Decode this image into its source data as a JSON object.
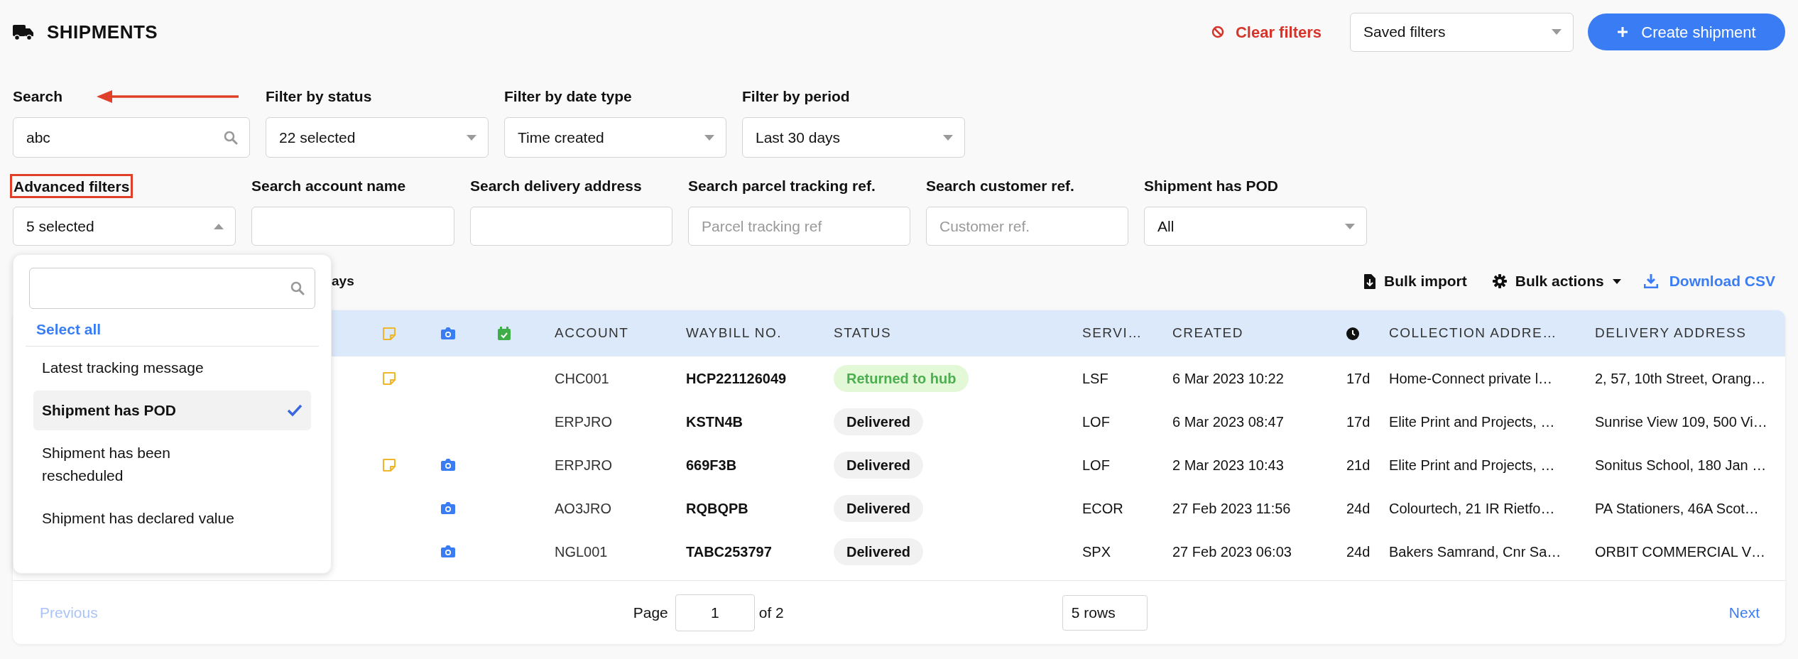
{
  "header": {
    "title": "SHIPMENTS",
    "clear_filters": "Clear filters",
    "saved_filters": "Saved filters",
    "create_button": "Create shipment"
  },
  "filters_row1": [
    {
      "label": "Search",
      "kind": "search",
      "value": "abc"
    },
    {
      "label": "Filter by status",
      "kind": "select",
      "value": "22 selected",
      "expanded": false
    },
    {
      "label": "Filter by date type",
      "kind": "select",
      "value": "Time created",
      "expanded": false
    },
    {
      "label": "Filter by period",
      "kind": "select",
      "value": "Last 30 days",
      "expanded": false
    }
  ],
  "filters_row2": [
    {
      "label": "Advanced filters",
      "kind": "select",
      "value": "5 selected",
      "expanded": true,
      "highlighted": true
    },
    {
      "label": "Search account name",
      "kind": "text",
      "highlighted": false
    },
    {
      "label": "Search delivery address",
      "kind": "text",
      "highlighted": false
    },
    {
      "label": "Search parcel tracking ref.",
      "kind": "text",
      "placeholder": "Parcel tracking ref",
      "highlighted": false
    },
    {
      "label": "Search customer ref.",
      "kind": "text",
      "placeholder": "Customer ref.",
      "highlighted": false
    },
    {
      "label": "Shipment has POD",
      "kind": "select",
      "value": "All",
      "expanded": false,
      "highlighted": false
    }
  ],
  "dropdown": {
    "select_all": "Select all",
    "options": [
      {
        "label": "Latest tracking message",
        "selected": false
      },
      {
        "label": "Shipment has POD",
        "selected": true
      },
      {
        "label": "Shipment has been rescheduled",
        "selected": false
      },
      {
        "label": "Shipment has declared value",
        "selected": false
      }
    ]
  },
  "summary_fragment": "ays",
  "toolbar": {
    "bulk_import": "Bulk import",
    "bulk_actions": "Bulk actions",
    "download_csv": "Download CSV"
  },
  "table": {
    "columns": [
      "ACCOUNT",
      "WAYBILL NO.",
      "STATUS",
      "SERVI…",
      "CREATED",
      "COLLECTION ADDRE…",
      "DELIVERY ADDRESS"
    ],
    "rows": [
      {
        "has_note": true,
        "has_photo": false,
        "account": "CHC001",
        "waybill": "HCP221126049",
        "status": {
          "label": "Returned to hub",
          "kind": "returned"
        },
        "service": "LSF",
        "created": "6 Mar 2023 10:22",
        "age": "17d",
        "collection": "Home-Connect private l…",
        "delivery": "2, 57, 10th Street, Orang…"
      },
      {
        "has_note": false,
        "has_photo": false,
        "account": "ERPJRO",
        "waybill": "KSTN4B",
        "status": {
          "label": "Delivered",
          "kind": "delivered"
        },
        "service": "LOF",
        "created": "6 Mar 2023 08:47",
        "age": "17d",
        "collection": "Elite Print and Projects, …",
        "delivery": "Sunrise View 109, 500 Vi…"
      },
      {
        "has_note": true,
        "has_photo": true,
        "account": "ERPJRO",
        "waybill": "669F3B",
        "status": {
          "label": "Delivered",
          "kind": "delivered"
        },
        "service": "LOF",
        "created": "2 Mar 2023 10:43",
        "age": "21d",
        "collection": "Elite Print and Projects, …",
        "delivery": "Sonitus School, 180 Jan …"
      },
      {
        "has_note": false,
        "has_photo": true,
        "account": "AO3JRO",
        "waybill": "RQBQPB",
        "status": {
          "label": "Delivered",
          "kind": "delivered"
        },
        "service": "ECOR",
        "created": "27 Feb 2023 11:56",
        "age": "24d",
        "collection": "Colourtech, 21 IR Rietfo…",
        "delivery": "PA Stationers, 46A Scot…"
      },
      {
        "has_note": false,
        "has_photo": true,
        "account": "NGL001",
        "waybill": "TABC253797",
        "status": {
          "label": "Delivered",
          "kind": "delivered"
        },
        "service": "SPX",
        "created": "27 Feb 2023 06:03",
        "age": "24d",
        "collection": "Bakers Samrand, Cnr Sa…",
        "delivery": "ORBIT COMMERCIAL V…"
      }
    ]
  },
  "pagination": {
    "previous": "Previous",
    "previous_disabled": true,
    "page_label": "Page",
    "page": "1",
    "of": "of 2",
    "rows": "5 rows",
    "next": "Next"
  }
}
